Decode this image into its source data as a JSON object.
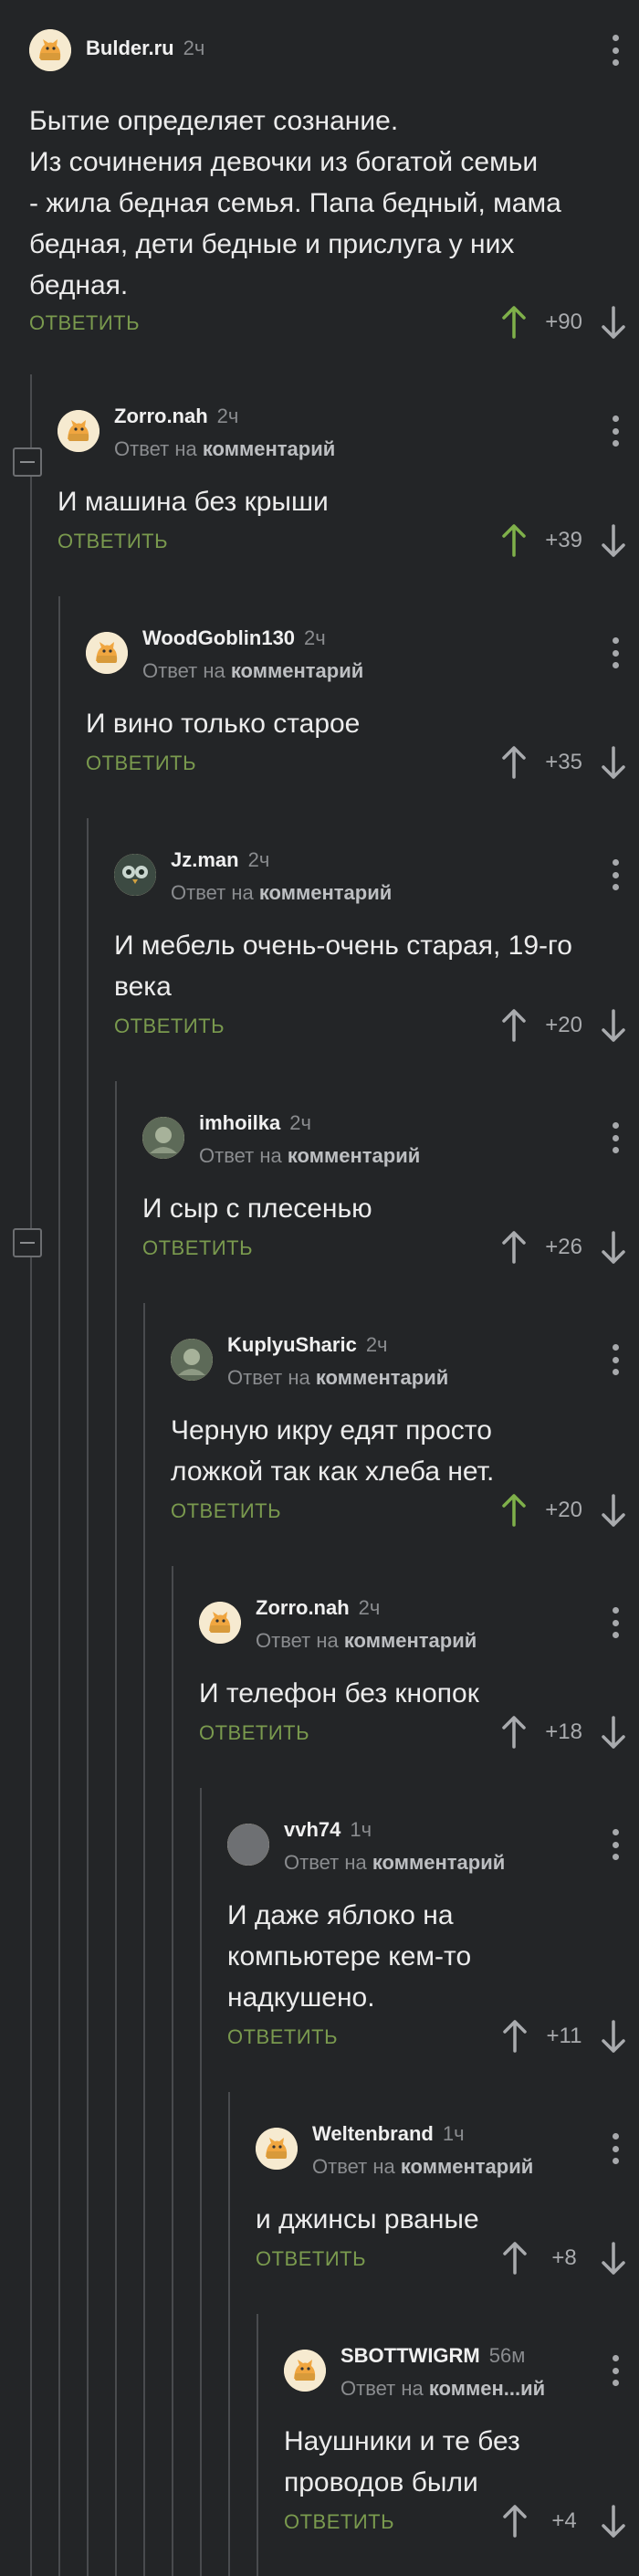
{
  "reply_label": "ОТВЕТИТЬ",
  "reply_to_prefix": "Ответ на",
  "colors": {
    "background": "#232527",
    "reply": "#7a9a4e",
    "upvote_active": "#7fb04a",
    "text": "#ececec",
    "muted": "#8a8c8f"
  },
  "comments": [
    {
      "author": "Bulder.ru",
      "time": "2ч",
      "reply_to": "",
      "text_lines": [
        "Бытие определяет сознание.",
        "Из сочинения девочки из богатой семьи",
        "- жила бедная семья. Папа бедный, мама",
        "бедная, дети бедные и прислуга у них",
        "бедная."
      ],
      "rating": "+90",
      "upvoted": true,
      "avatar": "cat-avatar-icon"
    },
    {
      "author": "Zorro.nah",
      "time": "2ч",
      "reply_to": "комментарий",
      "text_lines": [
        "И машина без крыши"
      ],
      "rating": "+39",
      "upvoted": true,
      "avatar": "cat-avatar-icon"
    },
    {
      "author": "WoodGoblin130",
      "time": "2ч",
      "reply_to": "комментарий",
      "text_lines": [
        "И вино только старое"
      ],
      "rating": "+35",
      "upvoted": false,
      "avatar": "cat-avatar-icon"
    },
    {
      "author": "Jz.man",
      "time": "2ч",
      "reply_to": "комментарий",
      "text_lines": [
        "И мебель очень-очень старая, 19-го",
        "века"
      ],
      "rating": "+20",
      "upvoted": false,
      "avatar": "owl-avatar-icon"
    },
    {
      "author": "imhoilka",
      "time": "2ч",
      "reply_to": "комментарий",
      "text_lines": [
        "И сыр с плесенью"
      ],
      "rating": "+26",
      "upvoted": false,
      "avatar": "photo-avatar-icon"
    },
    {
      "author": "KuplyuSharic",
      "time": "2ч",
      "reply_to": "комментарий",
      "text_lines": [
        "Черную икру едят просто",
        "ложкой так как хлеба нет."
      ],
      "rating": "+20",
      "upvoted": true,
      "avatar": "photo-avatar-icon"
    },
    {
      "author": "Zorro.nah",
      "time": "2ч",
      "reply_to": "комментарий",
      "text_lines": [
        "И телефон без кнопок"
      ],
      "rating": "+18",
      "upvoted": false,
      "avatar": "cat-avatar-icon"
    },
    {
      "author": "vvh74",
      "time": "1ч",
      "reply_to": "комментарий",
      "text_lines": [
        "И даже яблоко на",
        "компьютере кем-то",
        "надкушено."
      ],
      "rating": "+11",
      "upvoted": false,
      "avatar": "gray-avatar-icon"
    },
    {
      "author": "Weltenbrand",
      "time": "1ч",
      "reply_to": "комментарий",
      "text_lines": [
        "и джинсы рваные"
      ],
      "rating": "+8",
      "upvoted": false,
      "avatar": "cat-avatar-icon"
    },
    {
      "author": "SBOTTWIGRM",
      "time": "56м",
      "reply_to": "коммен...ий",
      "text_lines": [
        "Наушники и те без",
        "проводов были"
      ],
      "rating": "+4",
      "upvoted": false,
      "avatar": "cat-avatar-icon"
    }
  ]
}
